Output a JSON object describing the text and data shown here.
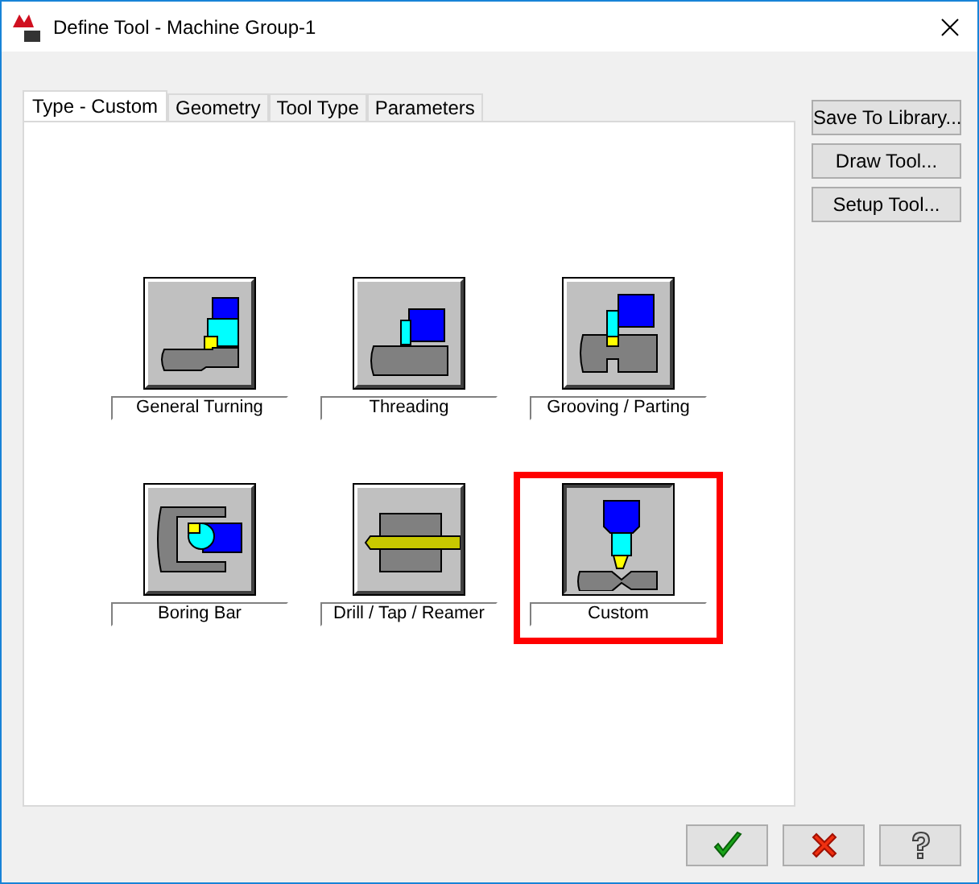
{
  "window": {
    "title": "Define Tool - Machine Group-1"
  },
  "tabs": [
    {
      "label": "Type - Custom",
      "selected": true
    },
    {
      "label": "Geometry",
      "selected": false
    },
    {
      "label": "Tool Type",
      "selected": false
    },
    {
      "label": "Parameters",
      "selected": false
    }
  ],
  "tools": [
    {
      "kind": "turning",
      "label": "General Turning",
      "selected": false
    },
    {
      "kind": "threading",
      "label": "Threading",
      "selected": false
    },
    {
      "kind": "grooving",
      "label": "Grooving / Parting",
      "selected": false
    },
    {
      "kind": "boring",
      "label": "Boring Bar",
      "selected": false
    },
    {
      "kind": "drill",
      "label": "Drill / Tap / Reamer",
      "selected": false
    },
    {
      "kind": "custom",
      "label": "Custom",
      "selected": true
    }
  ],
  "side_buttons": [
    "Save To Library...",
    "Draw Tool...",
    "Setup Tool..."
  ]
}
